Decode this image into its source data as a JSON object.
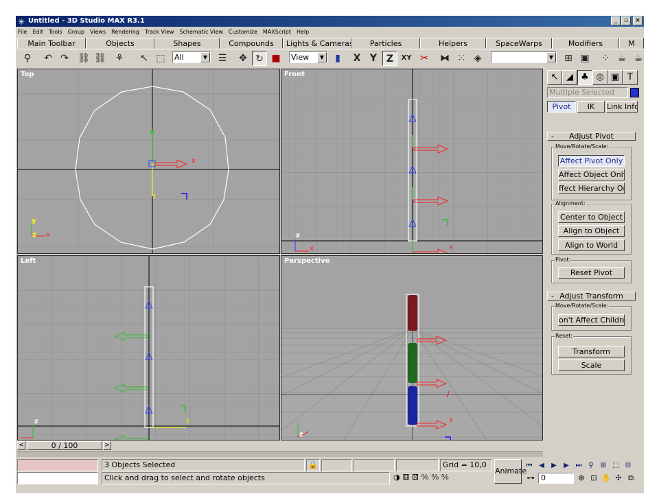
{
  "window": {
    "title": "Untitled - 3D Studio MAX R3.1",
    "controls": [
      "_",
      "▫",
      "×"
    ]
  },
  "menu": [
    "File",
    "Edit",
    "Tools",
    "Group",
    "Views",
    "Rendering",
    "Track View",
    "Schematic View",
    "Customize",
    "MAXScript",
    "Help"
  ],
  "tabs": [
    "Main Toolbar",
    "Objects",
    "Shapes",
    "Compounds",
    "Lights & Cameras",
    "Particles",
    "Helpers",
    "SpaceWarps",
    "Modifiers",
    "M"
  ],
  "toolbar": {
    "selection_filter": "All",
    "ref_coord": "View",
    "axis_x": "X",
    "axis_y": "Y",
    "axis_z": "Z",
    "axis_xy": "XY",
    "named_selection": ""
  },
  "viewports": {
    "top": "Top",
    "front": "Front",
    "left": "Left",
    "perspective": "Perspective"
  },
  "axis_labels": {
    "x": "x",
    "y": "y",
    "z": "z"
  },
  "command_panel": {
    "name_field": "Multiple Selected",
    "swatch_color": "#2233cc",
    "subtabs": [
      "Pivot",
      "IK",
      "Link Info"
    ],
    "adjust_pivot": {
      "title": "Adjust Pivot",
      "move_group": "Move/Rotate/Scale:",
      "affect_pivot_only": "Affect Pivot Only",
      "affect_object_only": "Affect Object Only",
      "affect_hierarchy_only": "ffect Hierarchy On",
      "alignment_group": "Alignment:",
      "center_to_object": "Center to Object",
      "align_to_object": "Align to Object",
      "align_to_world": "Align to World",
      "pivot_group": "Pivot:",
      "reset_pivot": "Reset Pivot"
    },
    "adjust_transform": {
      "title": "Adjust Transform",
      "move_group": "Move/Rotate/Scale:",
      "dont_affect_children": "on't Affect Childre",
      "reset_group": "Reset:",
      "transform": "Transform",
      "scale": "Scale"
    }
  },
  "timeline": {
    "position": "0 / 100"
  },
  "status": {
    "selection": "3 Objects Selected",
    "prompt": "Click and drag to select and rotate objects",
    "grid": "Grid = 10,0",
    "animate": "Animate",
    "frame": "0"
  },
  "colors": {
    "viewport_bg": "#a3a3a3",
    "grid_minor": "#999999",
    "grid_major": "#8a8a8a",
    "axis_line": "#000000",
    "gizmo_red": "#ff2020",
    "gizmo_green": "#30c030",
    "gizmo_blue": "#3040ff"
  }
}
